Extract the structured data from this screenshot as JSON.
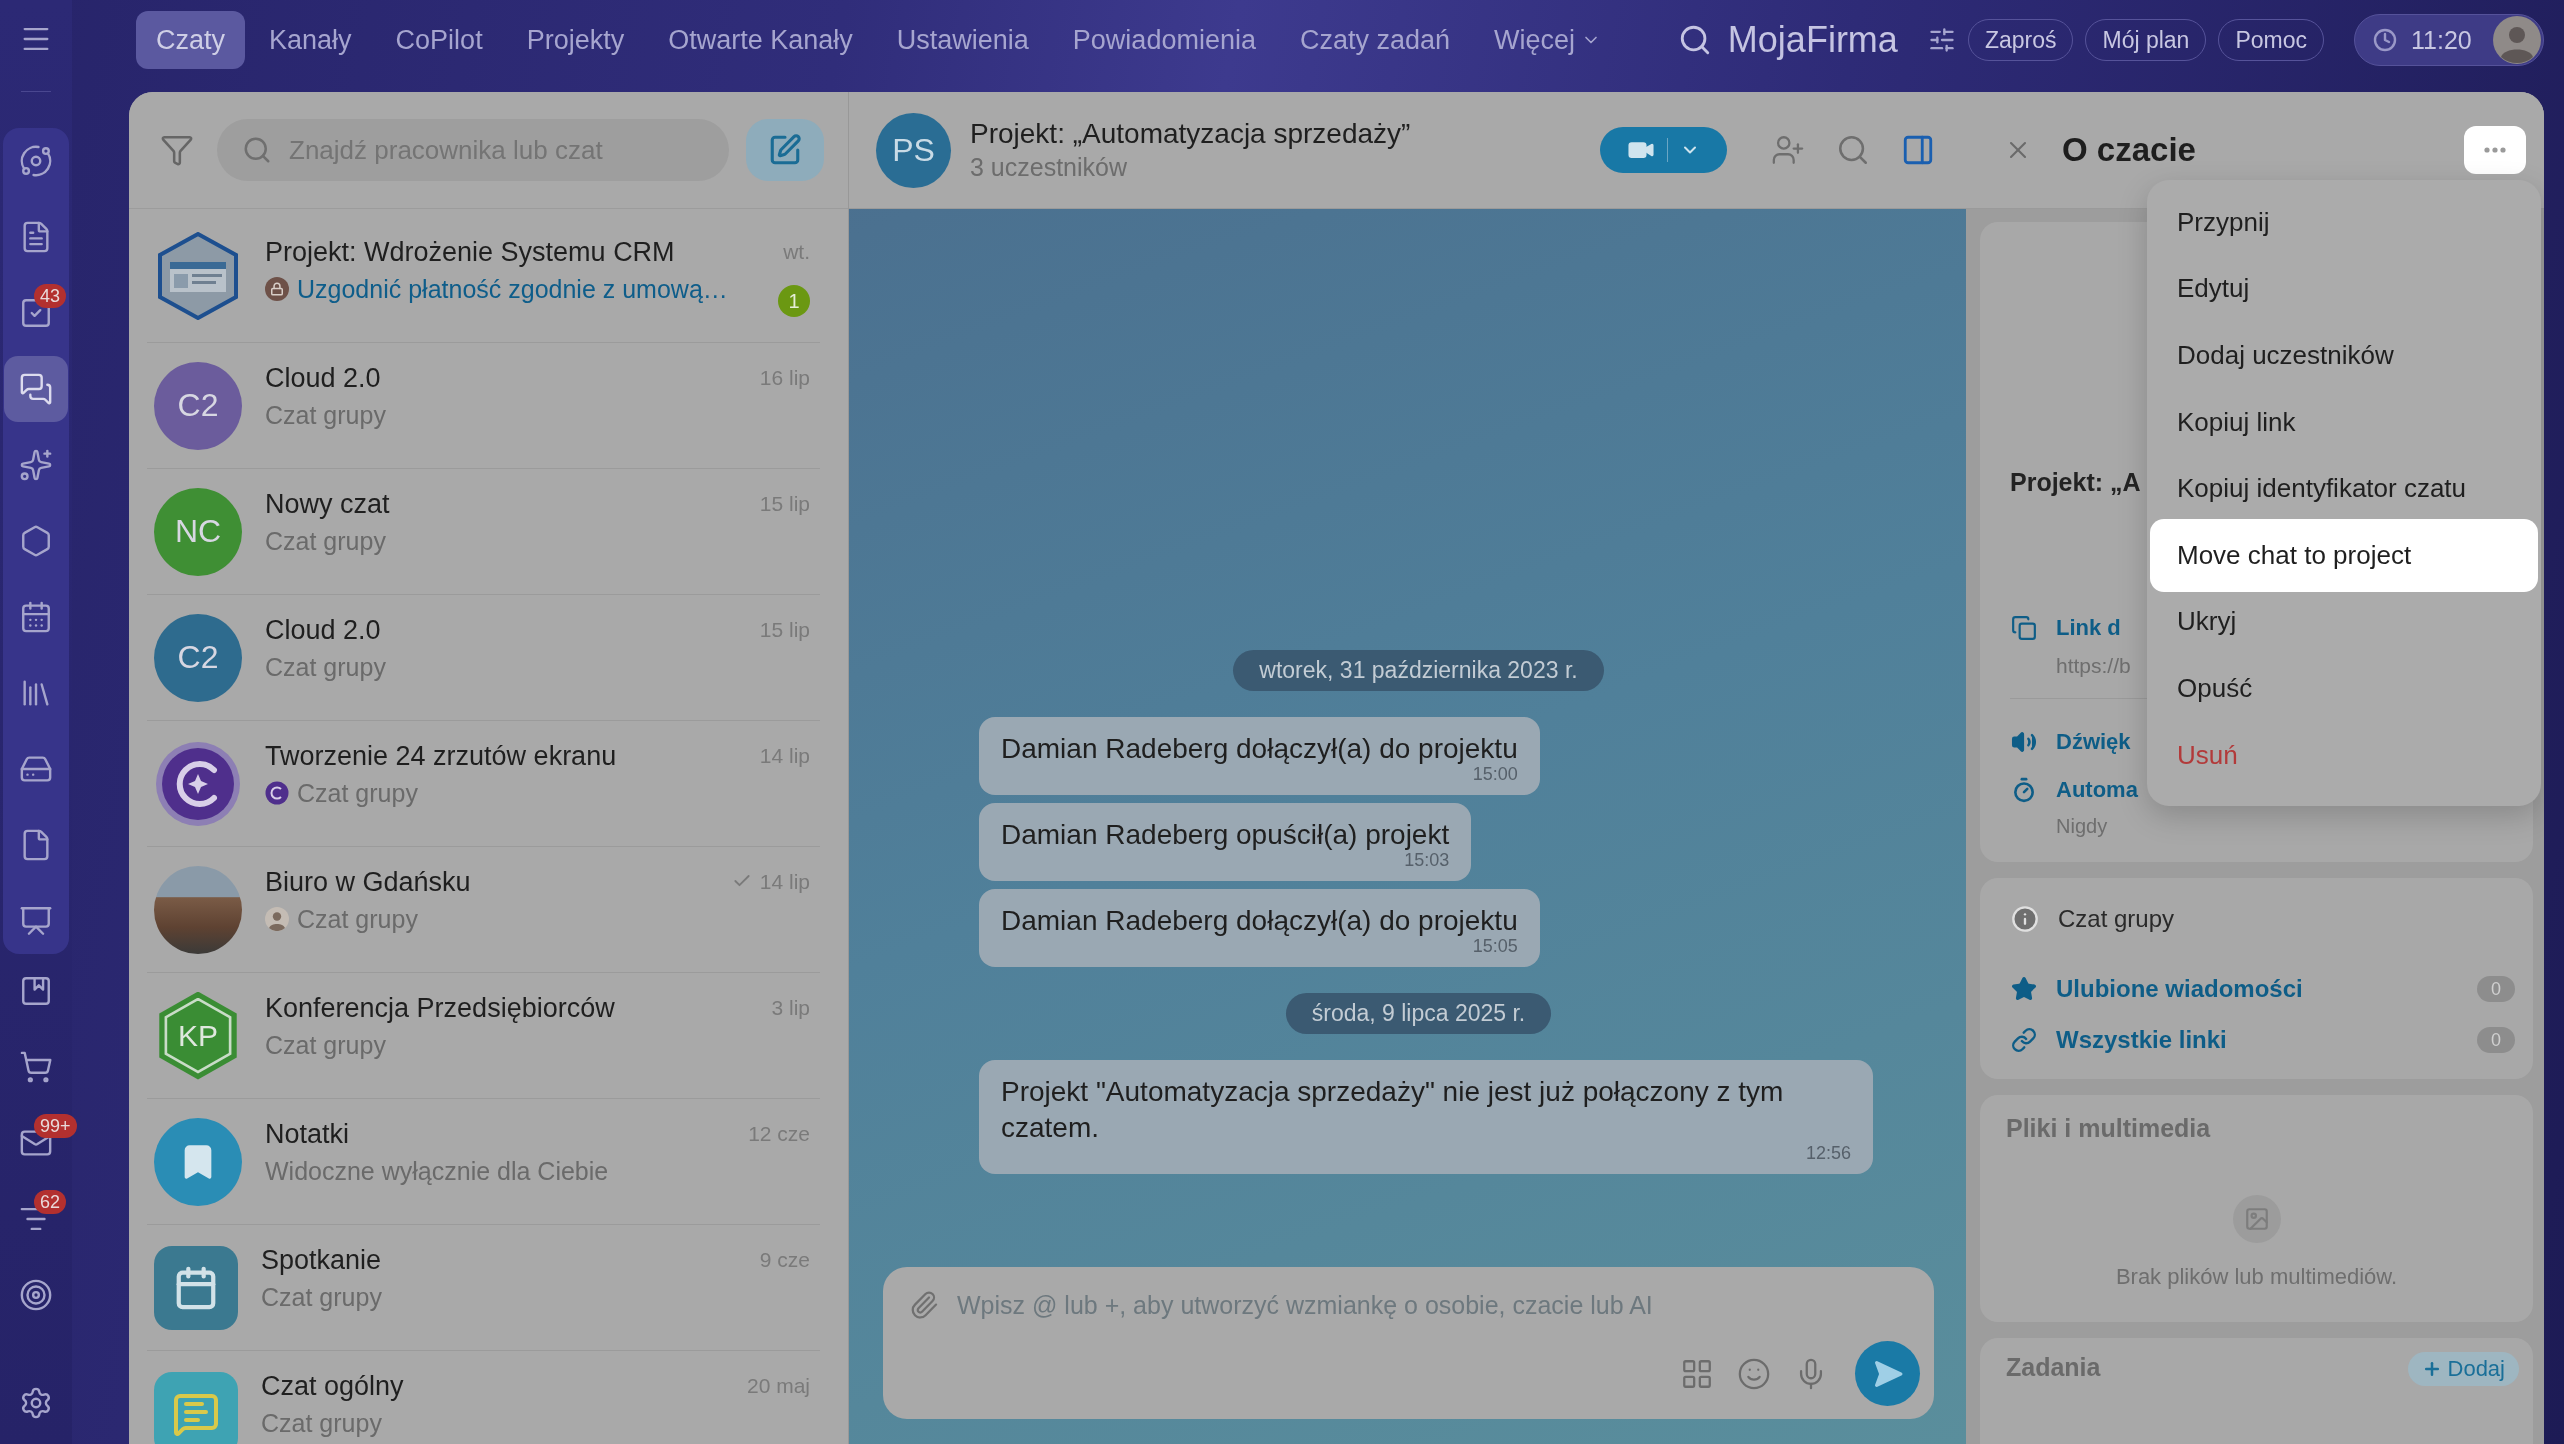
{
  "top_nav": {
    "tabs": [
      {
        "label": "Czaty",
        "selected": true,
        "kind": "link"
      },
      {
        "label": "Kanały",
        "selected": false,
        "kind": "link"
      },
      {
        "label": "CoPilot",
        "selected": false,
        "kind": "link"
      },
      {
        "label": "Projekty",
        "selected": false,
        "kind": "link"
      },
      {
        "label": "Otwarte Kanały",
        "selected": false,
        "kind": "link"
      },
      {
        "label": "Ustawienia",
        "selected": false,
        "kind": "link"
      },
      {
        "label": "Powiadomienia",
        "selected": false,
        "kind": "link"
      },
      {
        "label": "Czaty zadań",
        "selected": false,
        "kind": "link"
      },
      {
        "label": "Więcej",
        "selected": false,
        "kind": "menu"
      }
    ],
    "brand": "MojaFirma",
    "buttons": [
      "Zaproś",
      "Mój plan",
      "Pomoc"
    ],
    "clock": "11:20"
  },
  "rail": {
    "pinned": [
      {
        "selected": false
      },
      {
        "selected": false
      },
      {
        "selected": false,
        "badge": "43"
      },
      {
        "selected": true
      },
      {
        "selected": false
      },
      {
        "selected": false
      },
      {
        "selected": false
      },
      {
        "selected": false
      },
      {
        "selected": false
      },
      {
        "selected": false
      },
      {
        "selected": false
      }
    ],
    "items": [
      {
        "selected": false
      },
      {
        "selected": false
      },
      {
        "selected": false,
        "badge": "99+"
      },
      {
        "selected": false,
        "badge": "62"
      },
      {
        "selected": false
      }
    ]
  },
  "chat_list": {
    "search": {
      "placeholder": "Znajdź pracownika lub czat"
    },
    "chats": [
      {
        "title": "Projekt: Wdrożenie Systemu CRM",
        "preview": {
          "text": "Uzgodnić płatność zgodnie z umową…",
          "kind": "lock"
        },
        "date": "wt.",
        "read": false,
        "unread": "1",
        "avatar": {
          "kind": "screenshot"
        }
      },
      {
        "title": "Cloud 2.0",
        "preview": {
          "text": "Czat grupy",
          "kind": "plain"
        },
        "date": "16 lip",
        "read": false,
        "avatar": {
          "kind": "initials",
          "text": "C2",
          "color": "#6b5c9c"
        }
      },
      {
        "title": "Nowy czat",
        "preview": {
          "text": "Czat grupy",
          "kind": "plain"
        },
        "date": "15 lip",
        "read": false,
        "avatar": {
          "kind": "initials",
          "text": "NC",
          "color": "#3f8f34"
        }
      },
      {
        "title": "Cloud 2.0",
        "preview": {
          "text": "Czat grupy",
          "kind": "plain"
        },
        "date": "15 lip",
        "read": false,
        "avatar": {
          "kind": "initials",
          "text": "C2",
          "color": "#2e6b8e"
        }
      },
      {
        "title": "Tworzenie 24 zrzutów ekranu",
        "preview": {
          "text": "Czat grupy",
          "kind": "logo"
        },
        "date": "14 lip",
        "read": false,
        "avatar": {
          "kind": "logo"
        }
      },
      {
        "title": "Biuro w Gdańsku",
        "preview": {
          "text": "Czat grupy",
          "kind": "avatar"
        },
        "date": "14 lip",
        "read": true,
        "avatar": {
          "kind": "photo"
        }
      },
      {
        "title": "Konferencja Przedsiębiorców",
        "preview": {
          "text": "Czat grupy",
          "kind": "plain"
        },
        "date": "3 lip",
        "read": false,
        "avatar": {
          "kind": "hex-initials",
          "text": "KP",
          "color": "#3a8d34"
        }
      },
      {
        "title": "Notatki",
        "preview": {
          "text": "Widoczne wyłącznie dla Ciebie",
          "kind": "plain"
        },
        "date": "12 cze",
        "read": false,
        "avatar": {
          "kind": "bookmark",
          "color": "#2a8db5"
        }
      },
      {
        "title": "Spotkanie",
        "preview": {
          "text": "Czat grupy",
          "kind": "plain"
        },
        "date": "9 cze",
        "read": false,
        "avatar": {
          "kind": "calendar",
          "color": "#3b7990"
        }
      },
      {
        "title": "Czat ogólny",
        "preview": {
          "text": "Czat grupy",
          "kind": "plain"
        },
        "date": "20 maj",
        "read": false,
        "avatar": {
          "kind": "chat",
          "color": "#3ea3b3"
        }
      }
    ]
  },
  "chat": {
    "header": {
      "avatar": "PS",
      "title": "Projekt: „Automatyzacja sprzedaży”",
      "subtitle": "3 uczestników",
      "panel_open": true
    },
    "messages": [
      {
        "kind": "date",
        "text": "wtorek, 31 października 2023 r."
      },
      {
        "kind": "system",
        "text": "Damian Radeberg dołączył(a) do projektu",
        "time": "15:00"
      },
      {
        "kind": "system",
        "text": "Damian Radeberg opuścił(a) projekt",
        "time": "15:03"
      },
      {
        "kind": "system",
        "text": "Damian Radeberg dołączył(a) do projektu",
        "time": "15:05"
      },
      {
        "kind": "date",
        "text": "środa, 9 lipca 2025 r."
      },
      {
        "kind": "system",
        "text": "Projekt \"Automatyzacja sprzedaży\" nie jest już połączony z tym czatem.",
        "time": "12:56"
      }
    ],
    "composer": {
      "placeholder": "Wpisz @ lub +, aby utworzyć wzmiankę o osobie, czacie lub AI"
    }
  },
  "details": {
    "title": "O czacie",
    "more_button": {
      "highlighted": true
    },
    "menu": {
      "items": [
        {
          "label": "Przypnij",
          "kind": "normal",
          "highlighted": false
        },
        {
          "label": "Edytuj",
          "kind": "normal",
          "highlighted": false
        },
        {
          "label": "Dodaj uczestników",
          "kind": "normal",
          "highlighted": false
        },
        {
          "label": "Kopiuj link",
          "kind": "normal",
          "highlighted": false
        },
        {
          "label": "Kopiuj identyfikator czatu",
          "kind": "normal",
          "highlighted": false
        },
        {
          "label": "Move chat to project",
          "kind": "normal",
          "highlighted": true
        },
        {
          "label": "Ukryj",
          "kind": "normal",
          "highlighted": false
        },
        {
          "label": "Opuść",
          "kind": "normal",
          "highlighted": false
        },
        {
          "label": "Usuń",
          "kind": "danger",
          "highlighted": false
        }
      ]
    },
    "summary": {
      "title": "Projekt: „A",
      "link_label": "Link d",
      "link_url": "https://b",
      "sound_label": "Dźwięk",
      "auto_label": "Automa",
      "auto_value": "Nigdy"
    },
    "info": {
      "type_label": "Czat grupy",
      "links": [
        {
          "label": "Ulubione wiadomości",
          "count": "0",
          "kind": "star"
        },
        {
          "label": "Wszystkie linki",
          "count": "0",
          "kind": "link"
        }
      ]
    },
    "media": {
      "title": "Pliki i multimedia",
      "empty": "Brak plików lub multimediów."
    },
    "tasks": {
      "title": "Zadania",
      "add_button": "Dodaj"
    }
  }
}
